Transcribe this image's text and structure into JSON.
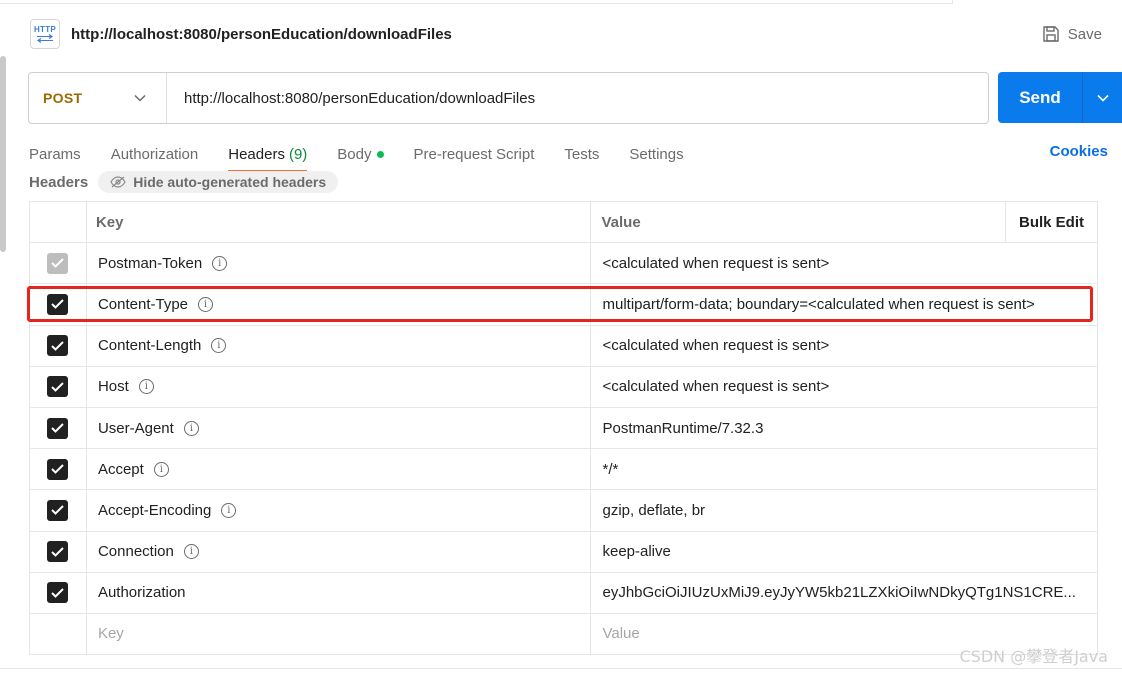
{
  "request": {
    "icon_text": "HTTP",
    "title": "http://localhost:8080/personEducation/downloadFiles",
    "save_label": "Save",
    "method": "POST",
    "url": "http://localhost:8080/personEducation/downloadFiles",
    "send_label": "Send"
  },
  "tabs": [
    {
      "label": "Params",
      "active": false
    },
    {
      "label": "Authorization",
      "active": false
    },
    {
      "label": "Headers",
      "count": "(9)",
      "active": true
    },
    {
      "label": "Body",
      "dot": true,
      "active": false
    },
    {
      "label": "Pre-request Script",
      "active": false
    },
    {
      "label": "Tests",
      "active": false
    },
    {
      "label": "Settings",
      "active": false
    }
  ],
  "cookies_label": "Cookies",
  "headers_section": {
    "label": "Headers",
    "hide_label": "Hide auto-generated headers"
  },
  "table": {
    "key_header": "Key",
    "value_header": "Value",
    "bulk_edit_label": "Bulk Edit",
    "rows": [
      {
        "key": "Postman-Token",
        "value": "<calculated when request is sent>",
        "checked": true,
        "disabled": true,
        "info": true
      },
      {
        "key": "Content-Type",
        "value": "multipart/form-data; boundary=<calculated when request is sent>",
        "checked": true,
        "info": true
      },
      {
        "key": "Content-Length",
        "value": "<calculated when request is sent>",
        "checked": true,
        "info": true
      },
      {
        "key": "Host",
        "value": "<calculated when request is sent>",
        "checked": true,
        "info": true
      },
      {
        "key": "User-Agent",
        "value": "PostmanRuntime/7.32.3",
        "checked": true,
        "info": true
      },
      {
        "key": "Accept",
        "value": "*/*",
        "checked": true,
        "info": true
      },
      {
        "key": "Accept-Encoding",
        "value": "gzip, deflate, br",
        "checked": true,
        "info": true
      },
      {
        "key": "Connection",
        "value": "keep-alive",
        "checked": true,
        "info": true
      },
      {
        "key": "Authorization",
        "value": "eyJhbGciOiJIUzUxMiJ9.eyJyYW5kb21LZXkiOiIwNDkyQTg1NS1CRE...",
        "checked": true,
        "info": false
      }
    ],
    "new_key_placeholder": "Key",
    "new_value_placeholder": "Value"
  },
  "watermark": "CSDN @攀登者Java",
  "colors": {
    "send": "#097bed",
    "method": "#9a6b00",
    "active_tab_underline": "#ff6c37",
    "highlight": "#e8251c",
    "cookies": "#0b6fe4"
  }
}
